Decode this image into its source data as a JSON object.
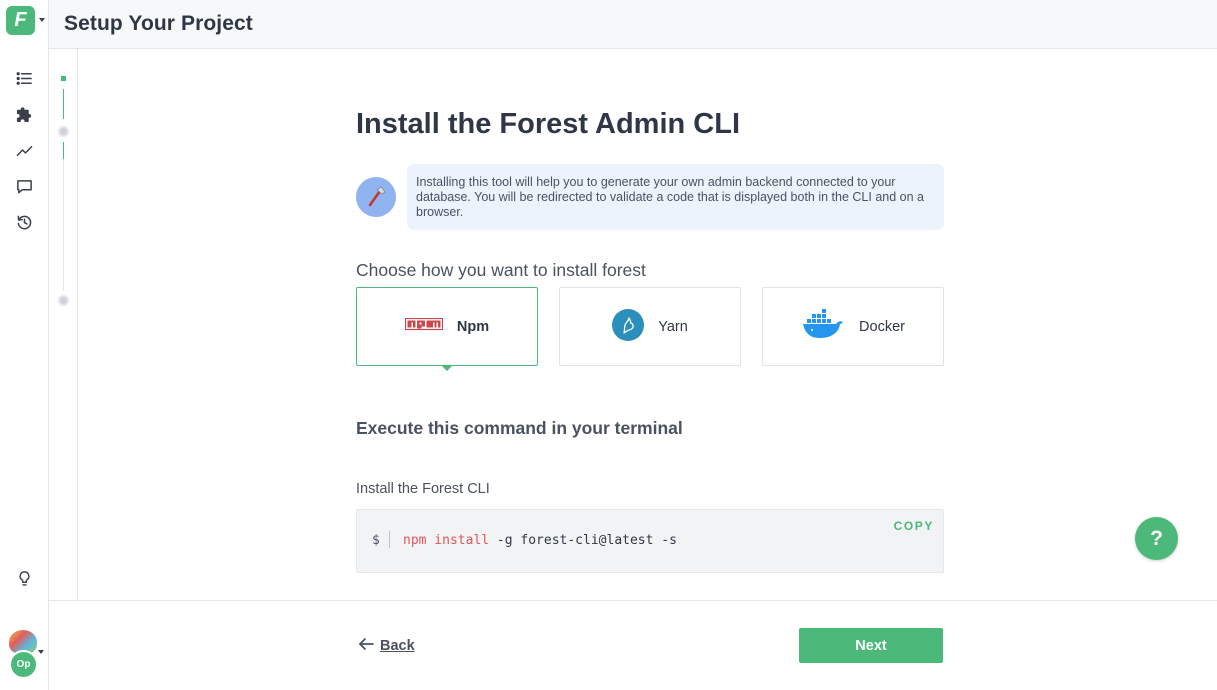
{
  "app": {
    "logo_letter": "F",
    "brand_color": "#4cb87a"
  },
  "header": {
    "title": "Setup Your Project"
  },
  "sidebar": {
    "items": [
      {
        "icon": "list-icon"
      },
      {
        "icon": "puzzle-icon"
      },
      {
        "icon": "trending-line-icon"
      },
      {
        "icon": "chat-bubble-icon"
      },
      {
        "icon": "history-icon"
      },
      {
        "icon": "lightbulb-icon"
      }
    ],
    "user_initials": "Op"
  },
  "main": {
    "title": "Install the Forest Admin CLI",
    "info_text": "Installing this tool will help you to generate your own admin backend connected to your database. You will be redirected to validate a code that is displayed both in the CLI and on a browser.",
    "choose_label": "Choose how you want to install forest",
    "options": [
      {
        "label": "Npm",
        "icon": "npm-logo-icon",
        "selected": true
      },
      {
        "label": "Yarn",
        "icon": "yarn-logo-icon",
        "selected": false
      },
      {
        "label": "Docker",
        "icon": "docker-logo-icon",
        "selected": false
      }
    ],
    "execute_label": "Execute this command in your terminal",
    "command": {
      "label": "Install the Forest CLI",
      "prompt": "$",
      "keyword": "npm install",
      "rest": " -g forest-cli@latest -s",
      "copy_label": "COPY"
    }
  },
  "footer": {
    "back_label": "Back",
    "next_label": "Next"
  },
  "help": {
    "label": "?"
  }
}
